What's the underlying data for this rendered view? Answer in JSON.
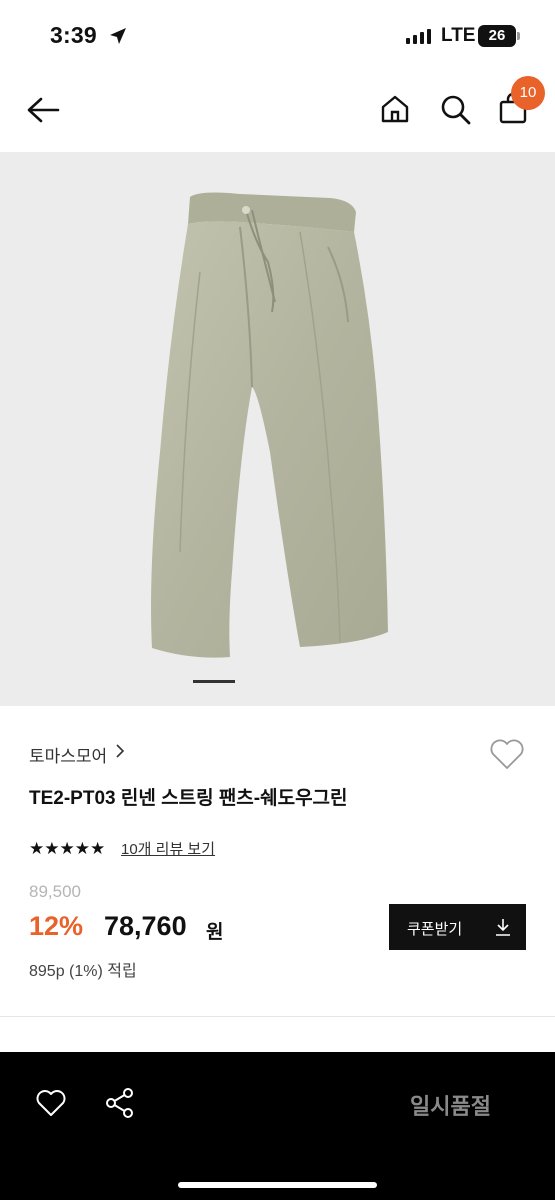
{
  "status_bar": {
    "time": "3:39",
    "network": "LTE",
    "battery": "26",
    "icons": [
      "location-arrow-icon",
      "signal-bars-icon",
      "battery-icon"
    ]
  },
  "nav": {
    "icons": [
      "back-arrow-icon",
      "home-icon",
      "search-icon",
      "cart-icon"
    ],
    "cart_count": "10"
  },
  "product_image": {
    "description_icon": "linen-pants-image",
    "slide_indicator_active": 1
  },
  "product": {
    "brand": "토마스모어",
    "title": "TE2-PT03 린넨 스트링 팬츠-쉐도우그린",
    "rating_stars": "★★★★★",
    "rating_value": 5,
    "review_link": "10개 리뷰 보기",
    "original_price": "89,500",
    "discount": "12%",
    "price": "78,760",
    "currency": "원",
    "points": "895p (1%) 적립"
  },
  "coupon": {
    "label": "쿠폰받기",
    "icon": "download-icon"
  },
  "bottom_bar": {
    "icons": [
      "heart-icon",
      "share-icon"
    ],
    "action_label": "일시품절"
  },
  "colors": {
    "accent": "#e8622a",
    "dark": "#111111",
    "bottom_bar": "#000000",
    "image_bg": "#ececec",
    "pants": "#b8b9a4"
  }
}
